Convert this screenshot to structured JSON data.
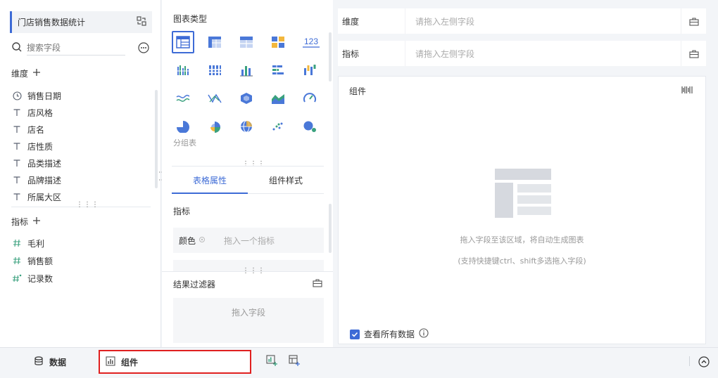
{
  "dataset": {
    "title": "门店销售数据统计"
  },
  "search": {
    "placeholder": "搜索字段"
  },
  "dimensions": {
    "title": "维度",
    "fields": [
      {
        "label": "销售日期",
        "type": "date"
      },
      {
        "label": "店风格",
        "type": "text"
      },
      {
        "label": "店名",
        "type": "text"
      },
      {
        "label": "店性质",
        "type": "text"
      },
      {
        "label": "品类描述",
        "type": "text"
      },
      {
        "label": "品牌描述",
        "type": "text"
      },
      {
        "label": "所属大区",
        "type": "text"
      }
    ]
  },
  "measures": {
    "title": "指标",
    "fields": [
      {
        "label": "毛利",
        "type": "number"
      },
      {
        "label": "销售额",
        "type": "number"
      },
      {
        "label": "记录数",
        "type": "count"
      }
    ]
  },
  "chart_types": {
    "title": "图表类型",
    "group_label": "分组表",
    "number_icon_text": "123",
    "selected_index": 0
  },
  "prop_tabs": [
    {
      "label": "表格属性",
      "active": true
    },
    {
      "label": "组件样式",
      "active": false
    }
  ],
  "properties": {
    "section": "指标",
    "color_label": "颜色",
    "color_placeholder": "拖入一个指标"
  },
  "result_filter": {
    "title": "结果过滤器",
    "placeholder": "拖入字段"
  },
  "drop_rows": [
    {
      "label": "维度",
      "placeholder": "请拖入左侧字段"
    },
    {
      "label": "指标",
      "placeholder": "请拖入左侧字段"
    }
  ],
  "canvas": {
    "title": "组件",
    "hint1": "拖入字段至该区域，将自动生成图表",
    "hint2": "(支持快捷键ctrl、shift多选拖入字段)",
    "view_all_label": "查看所有数据",
    "view_all_checked": true
  },
  "bottom": {
    "data_tab": "数据",
    "component_tab": "组件"
  },
  "colors": {
    "accent": "#3d6bd6",
    "highlight_border": "#e02020",
    "measure_icon": "#3aa17e"
  }
}
